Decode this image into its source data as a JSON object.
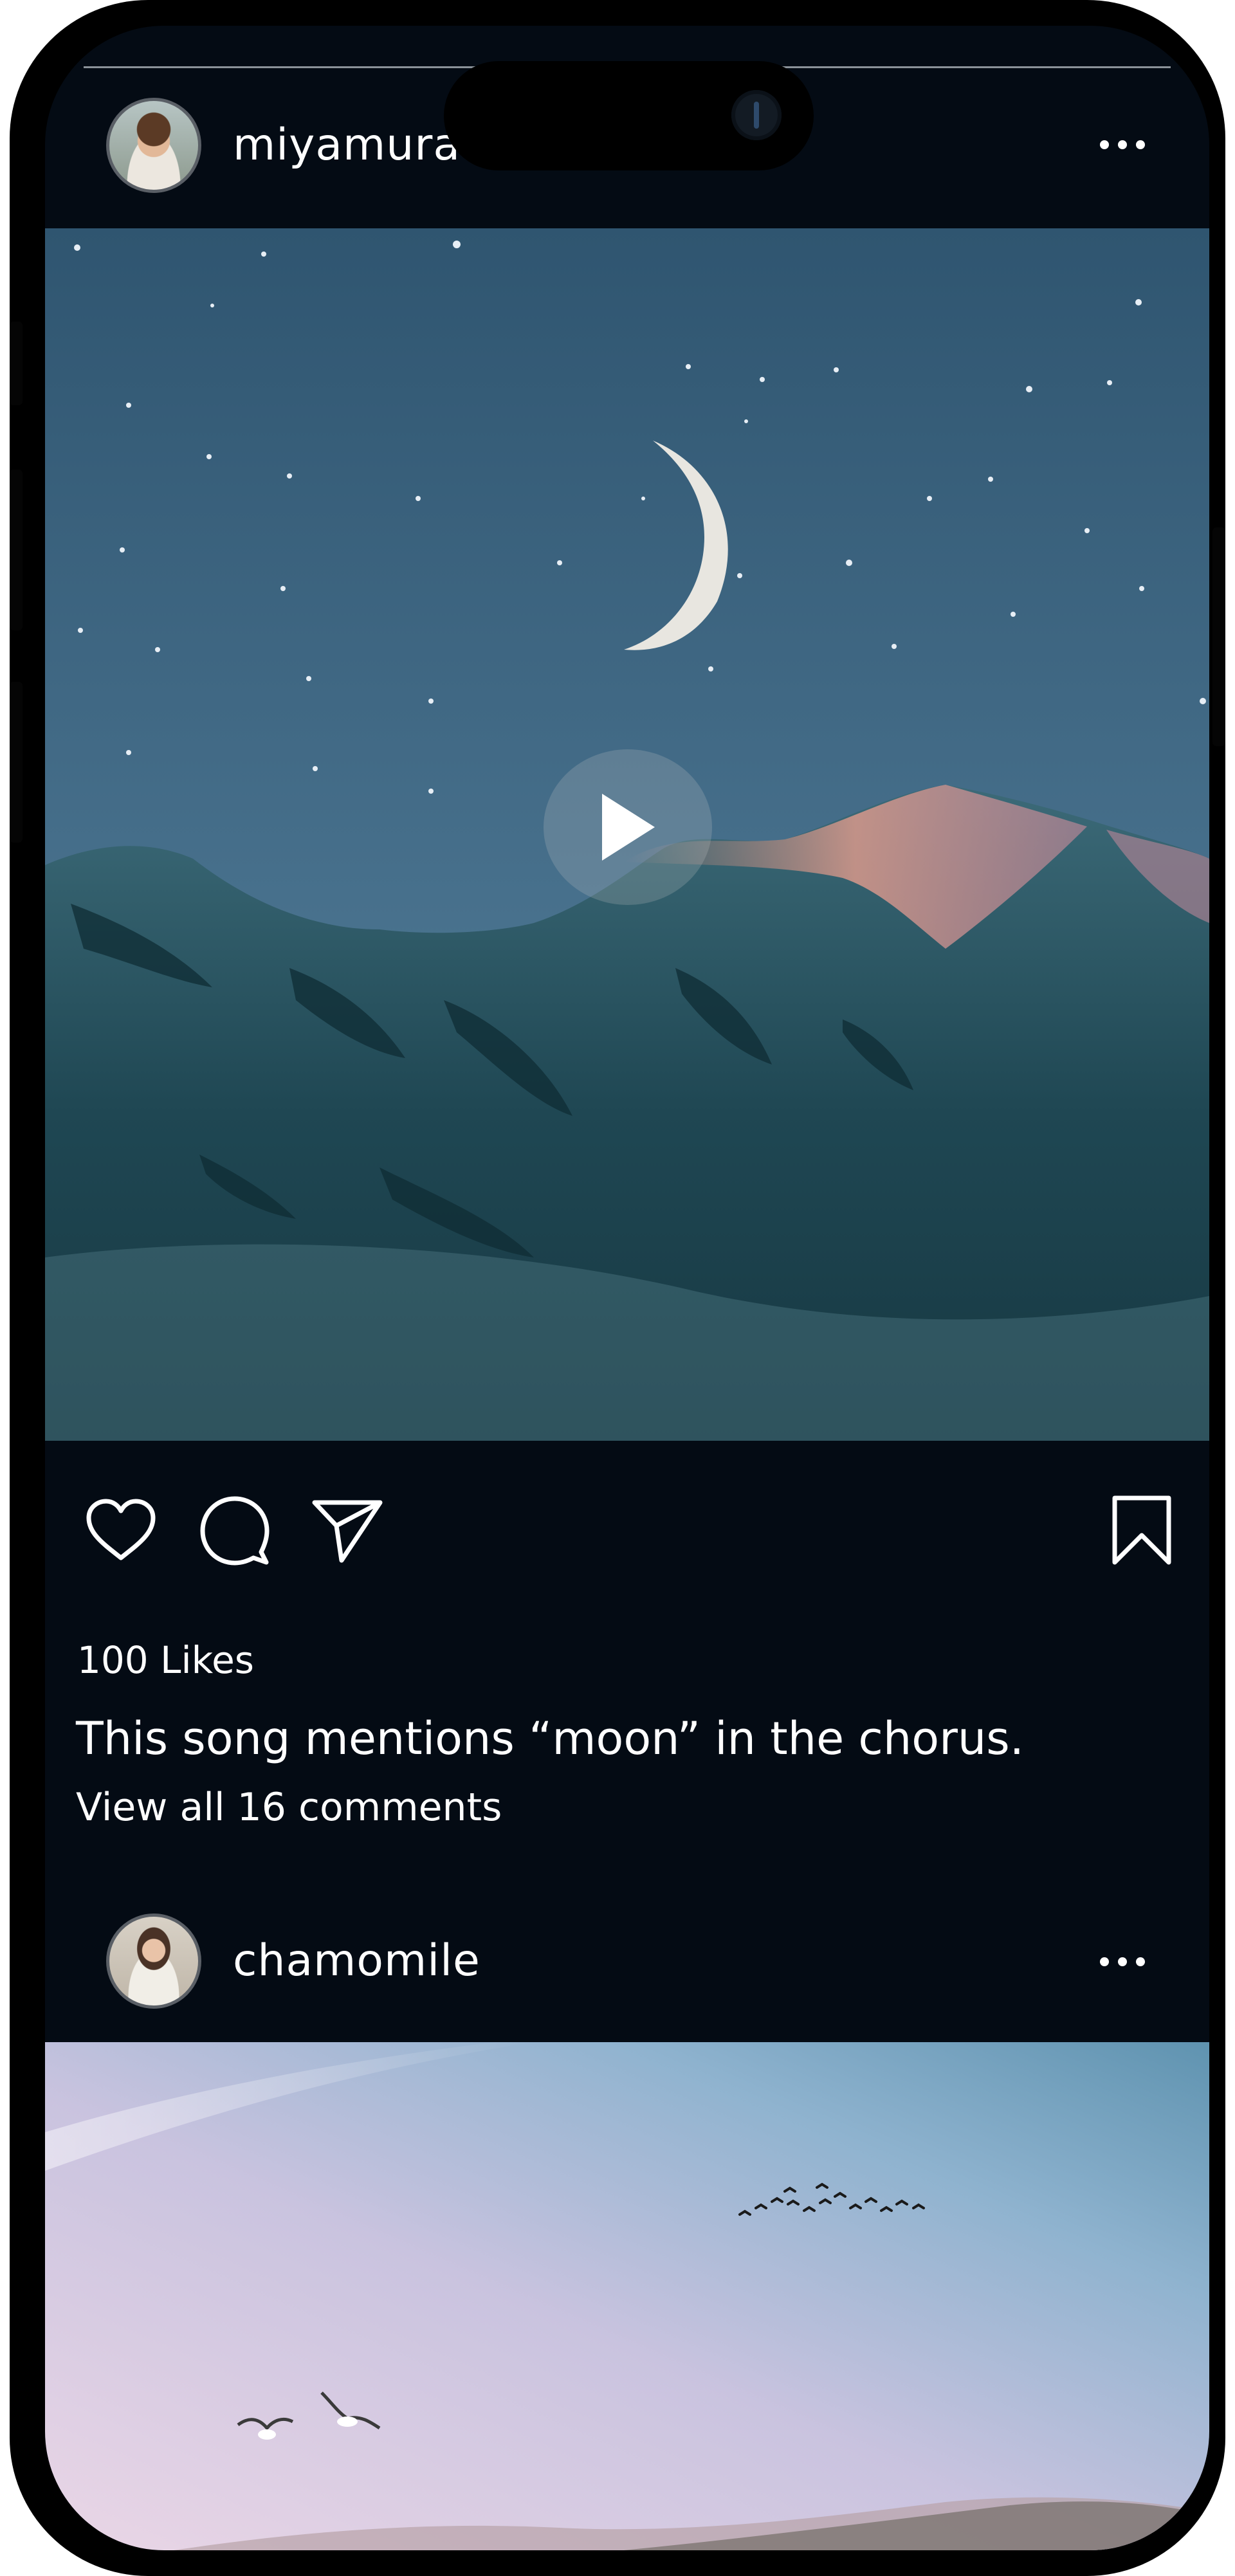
{
  "posts": [
    {
      "username": "miyamura",
      "media_type": "video",
      "likes": "100 Likes",
      "caption": "This song mentions “moon” in the chorus.",
      "view_comments": "View all 16 comments"
    },
    {
      "username": "chamomile",
      "media_type": "image"
    }
  ],
  "icons": {
    "more": "more-horizontal-icon",
    "play": "play-icon",
    "like": "heart-icon",
    "comment": "comment-bubble-icon",
    "share": "send-paper-plane-icon",
    "save": "bookmark-icon"
  },
  "colors": {
    "background": "#040b14",
    "text": "#ffffff",
    "frame": "#000000"
  }
}
